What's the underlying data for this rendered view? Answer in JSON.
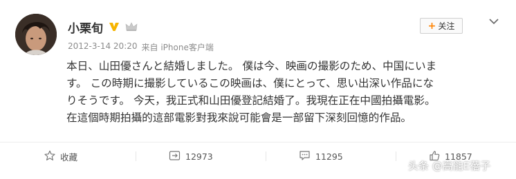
{
  "user": {
    "name": "小栗旬"
  },
  "meta": {
    "time": "2012-3-14 20:20",
    "source": "来自 iPhone客户端"
  },
  "follow": {
    "plus": "+",
    "label": "关注"
  },
  "post": {
    "lines": [
      "本日、山田優さんと結婚しました。 僕は今、映画の撮影のため、中国にいま",
      "す。 この時期に撮影しているこの映画は、僕にとって、思い出深い作品にな",
      "りそうです。 今天，我正式和山田優登記結婚了。我現在正在中國拍攝電影。",
      "在這個時期拍攝的這部電影對我來說可能會是一部留下深刻回憶的作品。"
    ]
  },
  "actions": {
    "favorite": {
      "label": "收藏",
      "icon": "star-icon"
    },
    "repost": {
      "count": "12973",
      "icon": "repost-icon"
    },
    "comment": {
      "count": "11295",
      "icon": "comment-icon"
    },
    "like": {
      "count": "11857",
      "icon": "thumbs-up-icon"
    }
  },
  "watermark": {
    "text": "头条 @高能E蓓子"
  },
  "colors": {
    "accent": "#ff8200",
    "vip": "#f6b400",
    "muted": "#8c8c8c"
  }
}
